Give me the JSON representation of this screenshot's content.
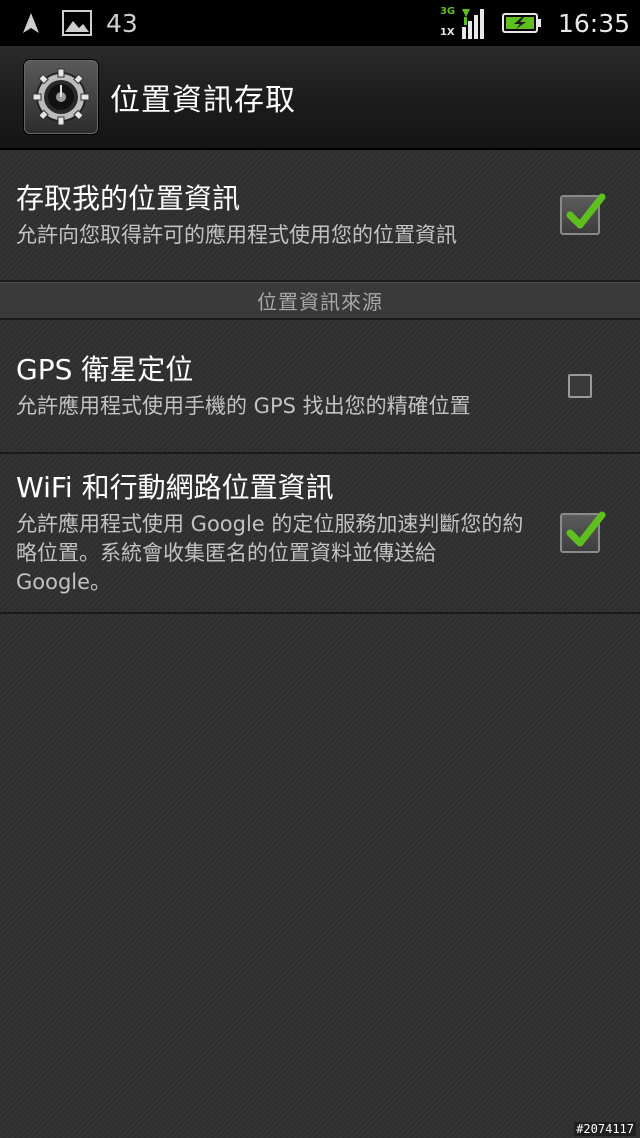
{
  "status_bar": {
    "notification_count": "43",
    "network_top": "3G",
    "network_bottom": "1X",
    "time": "16:35"
  },
  "action_bar": {
    "title": "位置資訊存取",
    "icon": "settings-gear-icon"
  },
  "settings": {
    "access_location": {
      "title": "存取我的位置資訊",
      "summary": "允許向您取得許可的應用程式使用您的位置資訊",
      "checked": true
    },
    "section_header": "位置資訊來源",
    "gps": {
      "title": "GPS 衛星定位",
      "summary": "允許應用程式使用手機的 GPS 找出您的精確位置",
      "checked": false
    },
    "wifi_mobile": {
      "title": "WiFi 和行動網路位置資訊",
      "summary": "允許應用程式使用 Google 的定位服務加速判斷您的約略位置。系統會收集匿名的位置資料並傳送給 Google。",
      "checked": true
    }
  },
  "watermark": "#2074117",
  "colors": {
    "check_green": "#5fbf1f",
    "background": "#303030",
    "status_bar": "#000000"
  }
}
